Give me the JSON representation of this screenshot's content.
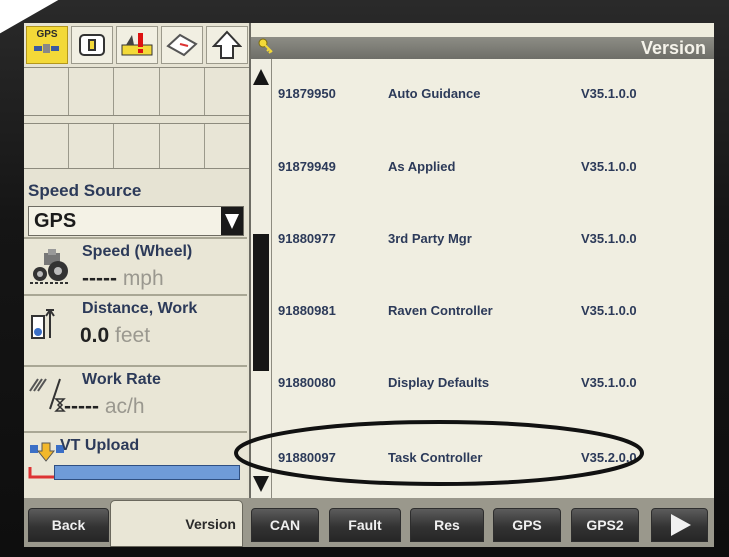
{
  "left_panel": {
    "gps_badge": "GPS",
    "speed_source": {
      "label": "Speed Source",
      "value": "GPS"
    },
    "speed": {
      "label": "Speed (Wheel)",
      "value": "-----",
      "unit": "mph"
    },
    "distance": {
      "label": "Distance, Work",
      "value": "0.0",
      "unit": "feet"
    },
    "work_rate": {
      "label": "Work Rate",
      "value": "-----",
      "unit": "ac/h"
    },
    "vt_upload": {
      "label": "VT Upload",
      "progress": 1.0
    }
  },
  "version_panel": {
    "title": "Version",
    "rows": [
      {
        "part": "91879950",
        "name": "Auto Guidance",
        "version": "V35.1.0.0"
      },
      {
        "part": "91879949",
        "name": "As Applied",
        "version": "V35.1.0.0"
      },
      {
        "part": "91880977",
        "name": "3rd Party Mgr",
        "version": "V35.1.0.0"
      },
      {
        "part": "91880981",
        "name": "Raven Controller",
        "version": "V35.1.0.0"
      },
      {
        "part": "91880080",
        "name": "Display Defaults",
        "version": "V35.1.0.0"
      },
      {
        "part": "91880097",
        "name": "Task Controller",
        "version": "V35.2.0.0"
      }
    ],
    "highlighted_row": 5
  },
  "bottom_bar": {
    "back": "Back",
    "version": "Version",
    "can": "CAN",
    "fault": "Fault",
    "res": "Res",
    "gps": "GPS",
    "gps2": "GPS2"
  },
  "colors": {
    "accent_yellow": "#f3d938",
    "label_navy": "#2c3a59",
    "header_gray": "#7d7d76",
    "highlight_ring": "#111111"
  }
}
